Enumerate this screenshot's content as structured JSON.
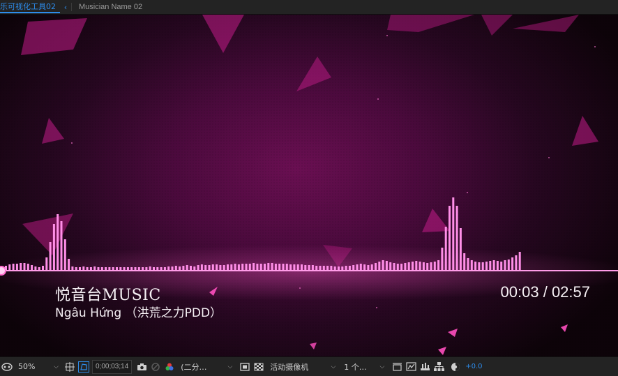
{
  "tabs": {
    "active_label": "乐可视化工具02",
    "chevron": "‹",
    "inactive_label": "Musician Name 02"
  },
  "viewer": {
    "title": "悦音台MUSIC",
    "subtitle": "Ngâu Hứng （洪荒之力PDD）",
    "time": "00:03 / 02:57",
    "colors": {
      "background": "#4a0a3c",
      "bars": "#ff8fe8",
      "shards": "#c21b88"
    },
    "spectrum_left": [
      6,
      8,
      9,
      9,
      10,
      10,
      9,
      7,
      5,
      4,
      6,
      18,
      40,
      66,
      80,
      70,
      44,
      16,
      5,
      4,
      4,
      5,
      4,
      4,
      5,
      4,
      4,
      4,
      4,
      4,
      4,
      4,
      4,
      4,
      4,
      4,
      4,
      4,
      4,
      5,
      4,
      4,
      4,
      4,
      5,
      5,
      6,
      5,
      6,
      7,
      6,
      5,
      7,
      8,
      7,
      7,
      8,
      8,
      7,
      7,
      8,
      8,
      9,
      8,
      9,
      9,
      9,
      10,
      9,
      9,
      9,
      10,
      10,
      9,
      9,
      9,
      9,
      8,
      8,
      8,
      8,
      7,
      7,
      7,
      6,
      6,
      6,
      6,
      6,
      5,
      5,
      5,
      6,
      6,
      7,
      8,
      9,
      8,
      7
    ],
    "spectrum_right": [
      8,
      10,
      12,
      14,
      13,
      11,
      10,
      9,
      9,
      10,
      11,
      12,
      13,
      12,
      11,
      10,
      11,
      12,
      14,
      32,
      62,
      92,
      104,
      92,
      60,
      24,
      17,
      14,
      12,
      11,
      11,
      12,
      13,
      14,
      13,
      12,
      14,
      15,
      18,
      21,
      26
    ]
  },
  "toolbar": {
    "zoom": "50%",
    "timecode": "0;00;03;14",
    "resolution": "(二分…",
    "camera": "活动摄像机",
    "views": "1 个…",
    "exposure": "+0.0"
  }
}
